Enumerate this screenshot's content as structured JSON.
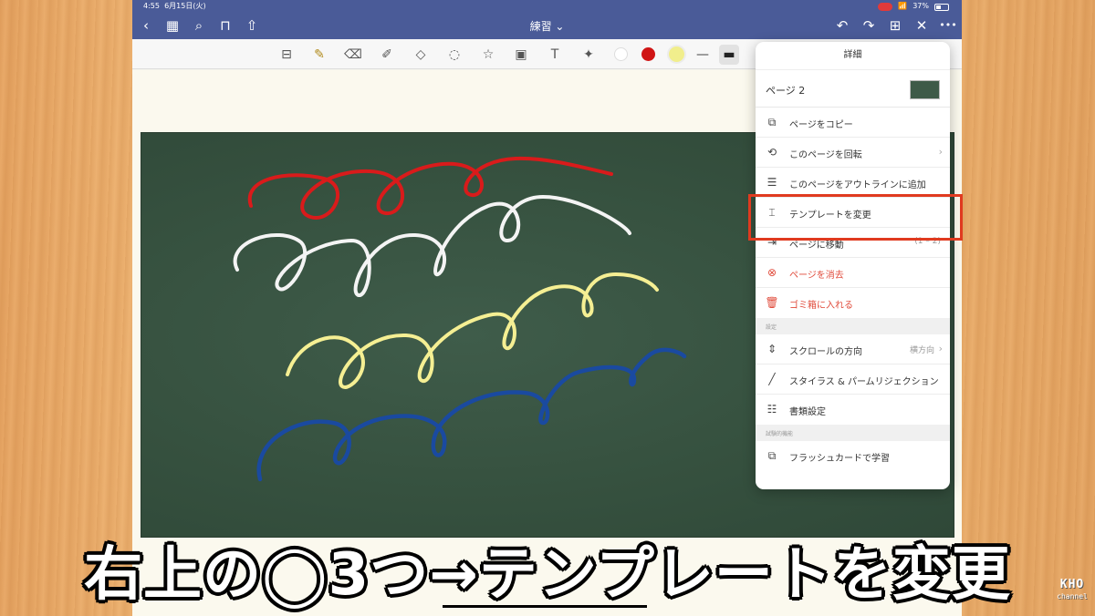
{
  "status_bar": {
    "time": "4:55",
    "date": "6月15日(火)",
    "wifi_icon": "📶",
    "battery": "37%"
  },
  "nav": {
    "title": "練習 ⌄",
    "back_icon": "‹",
    "grid_icon": "▦",
    "search_icon": "⌕",
    "bookmark_icon": "⊓",
    "share_icon": "⇧",
    "undo_icon": "↶",
    "redo_icon": "↷",
    "add_page_icon": "⊞",
    "close_icon": "✕",
    "more_icon": "•••"
  },
  "toolbar": {
    "tools": [
      "⊟",
      "✎",
      "⌫",
      "✐",
      "◇",
      "◌",
      "☆",
      "▣",
      "T",
      "✦"
    ],
    "colors": [
      "#ffffff",
      "#d01515",
      "#f1ee8c"
    ],
    "stroke_icons": [
      "—",
      "▬"
    ]
  },
  "menu": {
    "title": "詳細",
    "page_label": "ページ 2",
    "items": [
      {
        "icon": "⧉",
        "label": "ページをコピー",
        "value": "",
        "chevron": ""
      },
      {
        "icon": "⟲",
        "label": "このページを回転",
        "value": "",
        "chevron": "›"
      },
      {
        "icon": "☰",
        "label": "このページをアウトラインに追加",
        "value": "",
        "chevron": ""
      },
      {
        "icon": "⌶",
        "label": "テンプレートを変更",
        "value": "",
        "chevron": ""
      },
      {
        "icon": "⇥",
        "label": "ページに移動",
        "value": "(1 – 2)",
        "chevron": ""
      },
      {
        "icon": "⊗",
        "label": "ページを消去",
        "value": "",
        "chevron": ""
      },
      {
        "icon": "🗑",
        "label": "ゴミ箱に入れる",
        "value": "",
        "chevron": ""
      }
    ],
    "section_settings": "設定",
    "settings_items": [
      {
        "icon": "⇕",
        "label": "スクロールの方向",
        "value": "横方向",
        "chevron": "›"
      },
      {
        "icon": "╱",
        "label": "スタイラス & パームリジェクション",
        "value": "",
        "chevron": ""
      },
      {
        "icon": "☷",
        "label": "書類設定",
        "value": "",
        "chevron": ""
      }
    ],
    "section_experimental": "試験的機能",
    "experimental_items": [
      {
        "icon": "⧉",
        "label": "フラッシュカードで学習",
        "value": "",
        "chevron": ""
      }
    ]
  },
  "caption": "右上の◯3つ→テンプレートを変更",
  "logo": {
    "line1": "KHO",
    "line2": "channel"
  },
  "accent_colors": {
    "nav": "#4a5b98",
    "highlight": "#e03a1f",
    "danger": "#e04a3a"
  }
}
